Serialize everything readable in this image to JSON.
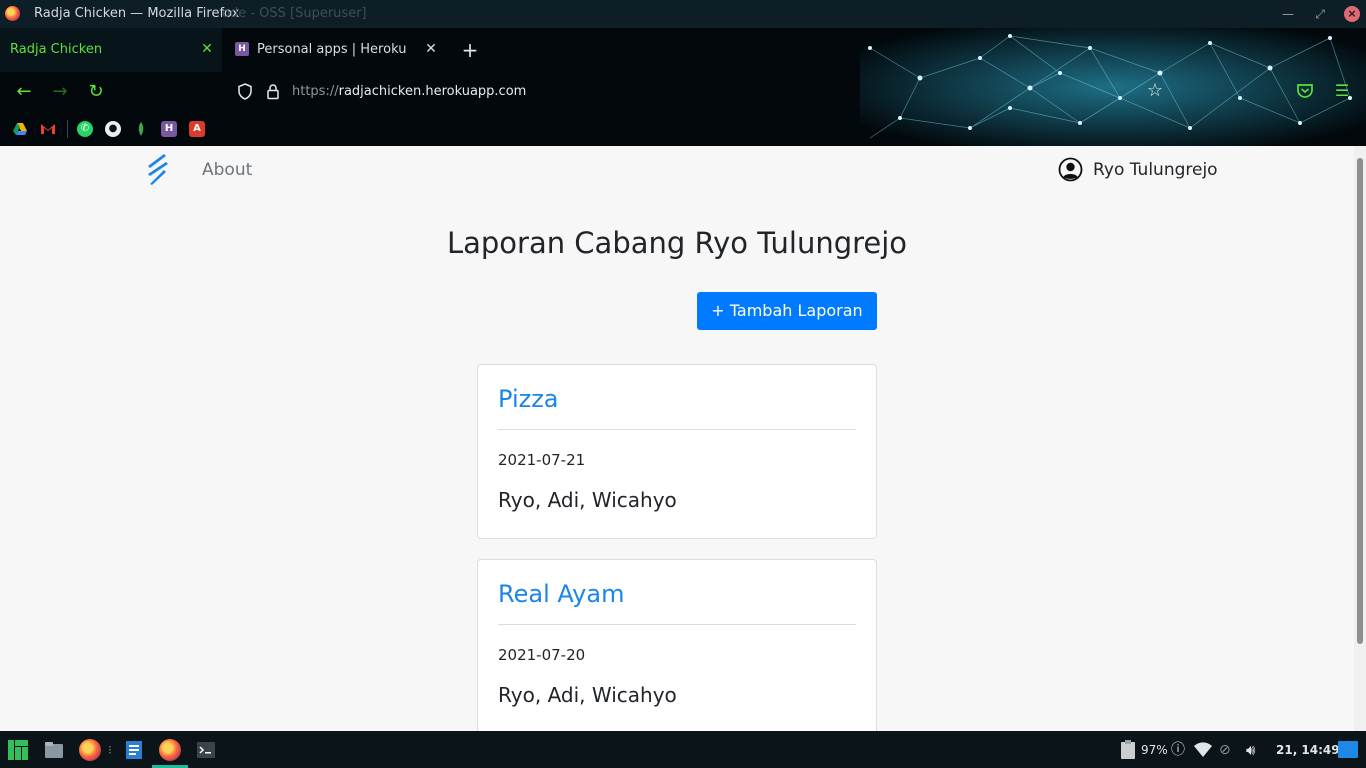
{
  "window": {
    "title": "Radja Chicken — Mozilla Firefox",
    "background_title": "ode - OSS [Superuser]"
  },
  "tabs": [
    {
      "label": "Radja Chicken",
      "active": true
    },
    {
      "label": "Personal apps | Heroku",
      "active": false
    }
  ],
  "url": {
    "protocol": "https://",
    "host": "radjachicken.herokuapp.com"
  },
  "bookmarks": [
    "google-drive-icon",
    "gmail-icon",
    "whatsapp-icon",
    "github-icon",
    "mongodb-icon",
    "heroku-icon",
    "angular-icon"
  ],
  "navbar": {
    "about_label": "About",
    "user_name": "Ryo Tulungrejo"
  },
  "main": {
    "heading": "Laporan Cabang Ryo Tulungrejo",
    "add_button_label": "+ Tambah Laporan",
    "reports": [
      {
        "title": "Pizza",
        "date": "2021-07-21",
        "staff": "Ryo, Adi, Wicahyo"
      },
      {
        "title": "Real Ayam",
        "date": "2021-07-20",
        "staff": "Ryo, Adi, Wicahyo"
      }
    ]
  },
  "taskbar": {
    "battery": "97%",
    "clock": "21, 14:49"
  },
  "colors": {
    "accent_green": "#5fe03a",
    "primary_blue": "#007bff",
    "link_blue": "#1c85e8"
  }
}
